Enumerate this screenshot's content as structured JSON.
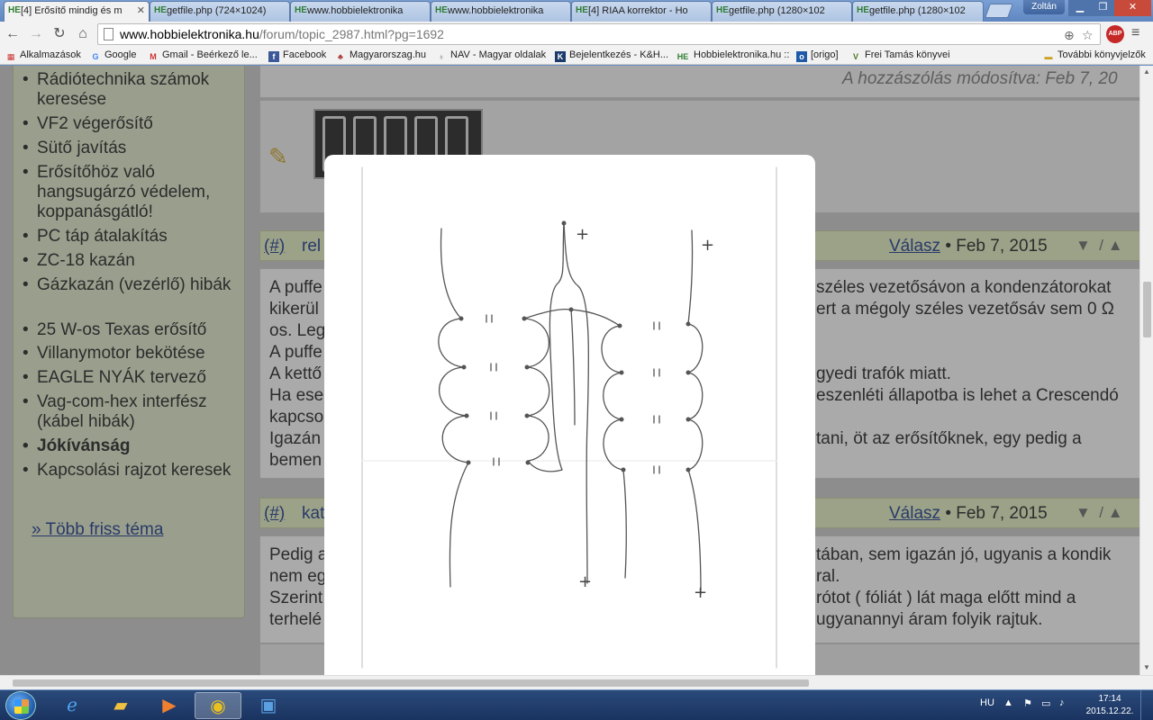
{
  "window": {
    "tabs": [
      {
        "favicon": "HE",
        "title": "[4] Erősítő mindig és m",
        "active": true
      },
      {
        "favicon": "HE",
        "title": "getfile.php (724×1024)",
        "active": false
      },
      {
        "favicon": "HE",
        "title": "www.hobbielektronika",
        "active": false
      },
      {
        "favicon": "HE",
        "title": "www.hobbielektronika",
        "active": false
      },
      {
        "favicon": "HE",
        "title": "[4] RIAA korrektor - Ho",
        "active": false
      },
      {
        "favicon": "HE",
        "title": "getfile.php (1280×102",
        "active": false
      },
      {
        "favicon": "HE",
        "title": "getfile.php (1280×102",
        "active": false
      }
    ],
    "user": "Zoltán",
    "minimize": "▁",
    "maximize": "❐",
    "close": "✕"
  },
  "toolbar": {
    "url_host": "www.hobbielektronika.hu",
    "url_path": "/forum/topic_2987.html?pg=1692",
    "abp_label": "ABP"
  },
  "bookmarks": [
    {
      "icon": "apps-icon",
      "label": "Alkalmazások"
    },
    {
      "icon": "google-icon",
      "label": "Google"
    },
    {
      "icon": "gmail-icon",
      "label": "Gmail - Beérkező le..."
    },
    {
      "icon": "facebook-icon",
      "label": "Facebook"
    },
    {
      "icon": "site-icon",
      "label": "Magyarorszag.hu"
    },
    {
      "icon": "site-icon",
      "label": "NAV - Magyar oldalak"
    },
    {
      "icon": "site-icon",
      "label": "Bejelentkezés - K&H..."
    },
    {
      "icon": "he-icon",
      "label": "Hobbielektronika.hu ::"
    },
    {
      "icon": "origo-icon",
      "label": "[origo]"
    },
    {
      "icon": "site-icon",
      "label": "Frei Tamás könyvei"
    },
    {
      "icon": "folder-icon",
      "label": "További könyvjelzők"
    }
  ],
  "sidebar": {
    "items": [
      {
        "label": "Rádiótechnika számok keresése",
        "bold": false
      },
      {
        "label": "VF2 végerősítő",
        "bold": false
      },
      {
        "label": "Sütő javítás",
        "bold": false
      },
      {
        "label": "Erősítőhöz való hangsugárzó védelem, koppanásgátló!",
        "bold": false
      },
      {
        "label": "PC táp átalakítás",
        "bold": false
      },
      {
        "label": "ZC-18 kazán",
        "bold": false
      },
      {
        "label": "Gázkazán (vezérlő) hibák",
        "bold": false
      },
      {
        "label": "25 W-os Texas erősítő",
        "bold": false
      },
      {
        "label": "Villanymotor bekötése",
        "bold": false
      },
      {
        "label": "EAGLE NYÁK tervező",
        "bold": false
      },
      {
        "label": "Vag-com-hex interfész (kábel hibák)",
        "bold": false
      },
      {
        "label": "Jókívánság",
        "bold": true
      },
      {
        "label": "Kapcsolási rajzot keresek",
        "bold": false
      }
    ],
    "more_link": "» Több friss téma"
  },
  "posts": {
    "edited_note": "A hozzászólás módosítva: Feb 7, 20",
    "post1": {
      "hash": "(#)",
      "user": "rel",
      "reply": "Válasz",
      "date": "• Feb 7, 2015",
      "lines_left": [
        "A puffe",
        "kikerül",
        "os. Leg",
        "A puffe",
        "A kettő",
        "Ha ese",
        "kapcso",
        "Igazán",
        "bemen"
      ],
      "lines_right": [
        "széles vezetősávon a kondenzátorokat",
        "ert a mégoly széles vezetősáv sem 0 Ω",
        "",
        "",
        "gyedi trafók miatt.",
        "eszenléti állapotba is lehet a Crescendó",
        "",
        "tani, öt az erősítőknek, egy pedig a",
        ""
      ]
    },
    "post2": {
      "hash": "(#)",
      "user": "kat",
      "reply": "Válasz",
      "date": "• Feb 7, 2015",
      "lines_left": [
        "Pedig a",
        "nem eg",
        "Szerint",
        "terhelé"
      ],
      "lines_right": [
        "tában, sem igazán jó, ugyanis a kondik",
        "ral.",
        "rótot ( fóliát ) lát maga előtt mind a",
        "ugyanannyi áram folyik rajtuk."
      ]
    }
  },
  "lightbox": {
    "terminal_labels": [
      "+",
      "+",
      "+",
      "+"
    ]
  },
  "taskbar": {
    "apps": [
      {
        "icon": "ie-icon",
        "active": false
      },
      {
        "icon": "explorer-icon",
        "active": false
      },
      {
        "icon": "media-player-icon",
        "active": false
      },
      {
        "icon": "chrome-icon",
        "active": true
      },
      {
        "icon": "save-disk-icon",
        "active": false
      }
    ],
    "language": "HU",
    "time": "17:14",
    "date": "2015.12.22."
  }
}
